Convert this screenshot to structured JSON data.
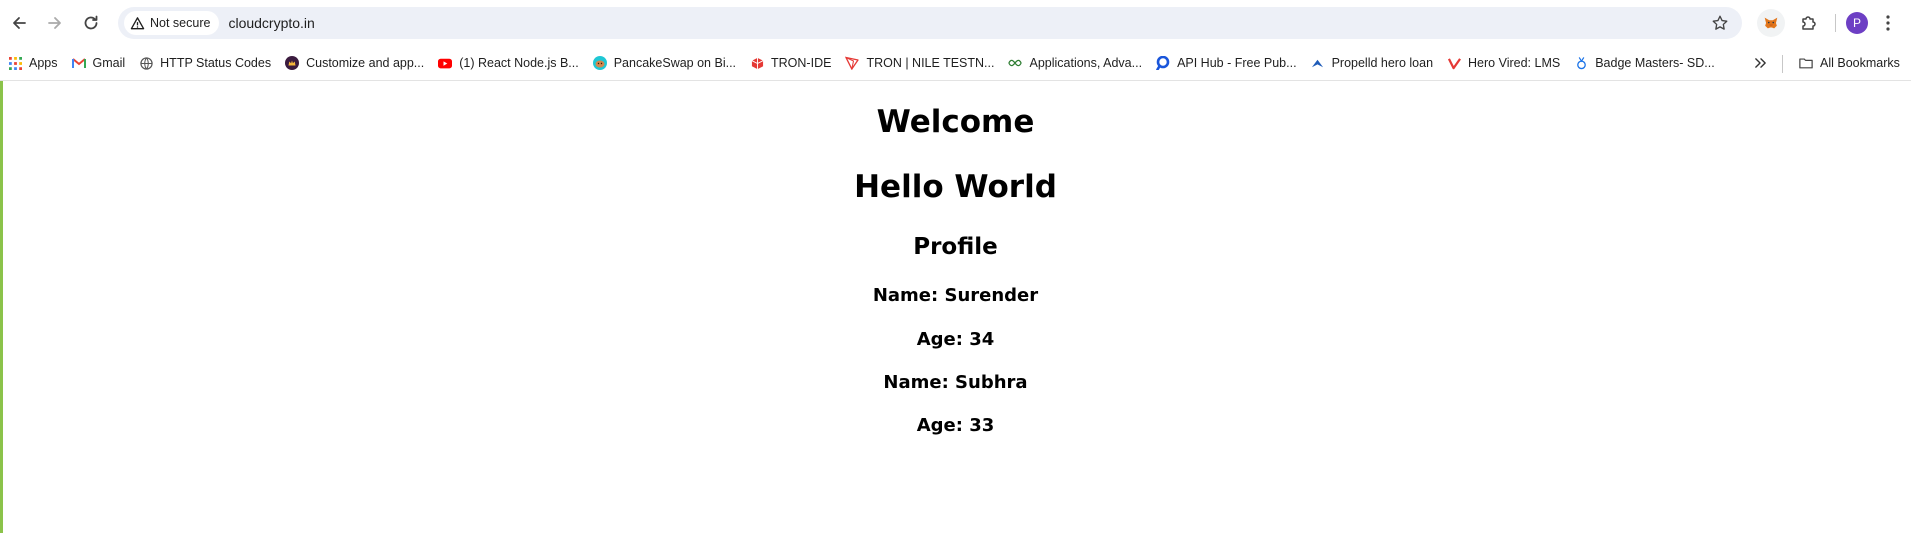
{
  "browser": {
    "security_label": "Not secure",
    "url": "cloudcrypto.in",
    "profile_initial": "P"
  },
  "bookmarks": {
    "items": [
      {
        "label": "Apps",
        "icon": "apps-grid-icon"
      },
      {
        "label": "Gmail",
        "icon": "gmail-icon"
      },
      {
        "label": "HTTP Status Codes",
        "icon": "globe-icon"
      },
      {
        "label": "Customize and app...",
        "icon": "crown-icon"
      },
      {
        "label": "(1) React Node.js B...",
        "icon": "youtube-icon"
      },
      {
        "label": "PancakeSwap on Bi...",
        "icon": "pancakeswap-icon"
      },
      {
        "label": "TRON-IDE",
        "icon": "tron-ide-icon"
      },
      {
        "label": "TRON | NILE TESTN...",
        "icon": "tron-icon"
      },
      {
        "label": "Applications, Adva...",
        "icon": "applications-icon"
      },
      {
        "label": "API Hub - Free Pub...",
        "icon": "api-hub-icon"
      },
      {
        "label": "Propelld hero loan",
        "icon": "propelld-icon"
      },
      {
        "label": "Hero Vired: LMS",
        "icon": "hero-vired-icon"
      },
      {
        "label": "Badge Masters- SD...",
        "icon": "badge-icon"
      }
    ],
    "all_bookmarks_label": "All Bookmarks"
  },
  "page": {
    "heading1": "Welcome",
    "heading2": "Hello World",
    "profile_heading": "Profile",
    "lines": [
      "Name: Surender",
      "Age: 34",
      "Name: Subhra",
      "Age: 33"
    ]
  },
  "colors": {
    "omnibox_bg": "#edf0f7",
    "avatar": "#6d3fc4",
    "left_accent": "#8bc34a"
  }
}
